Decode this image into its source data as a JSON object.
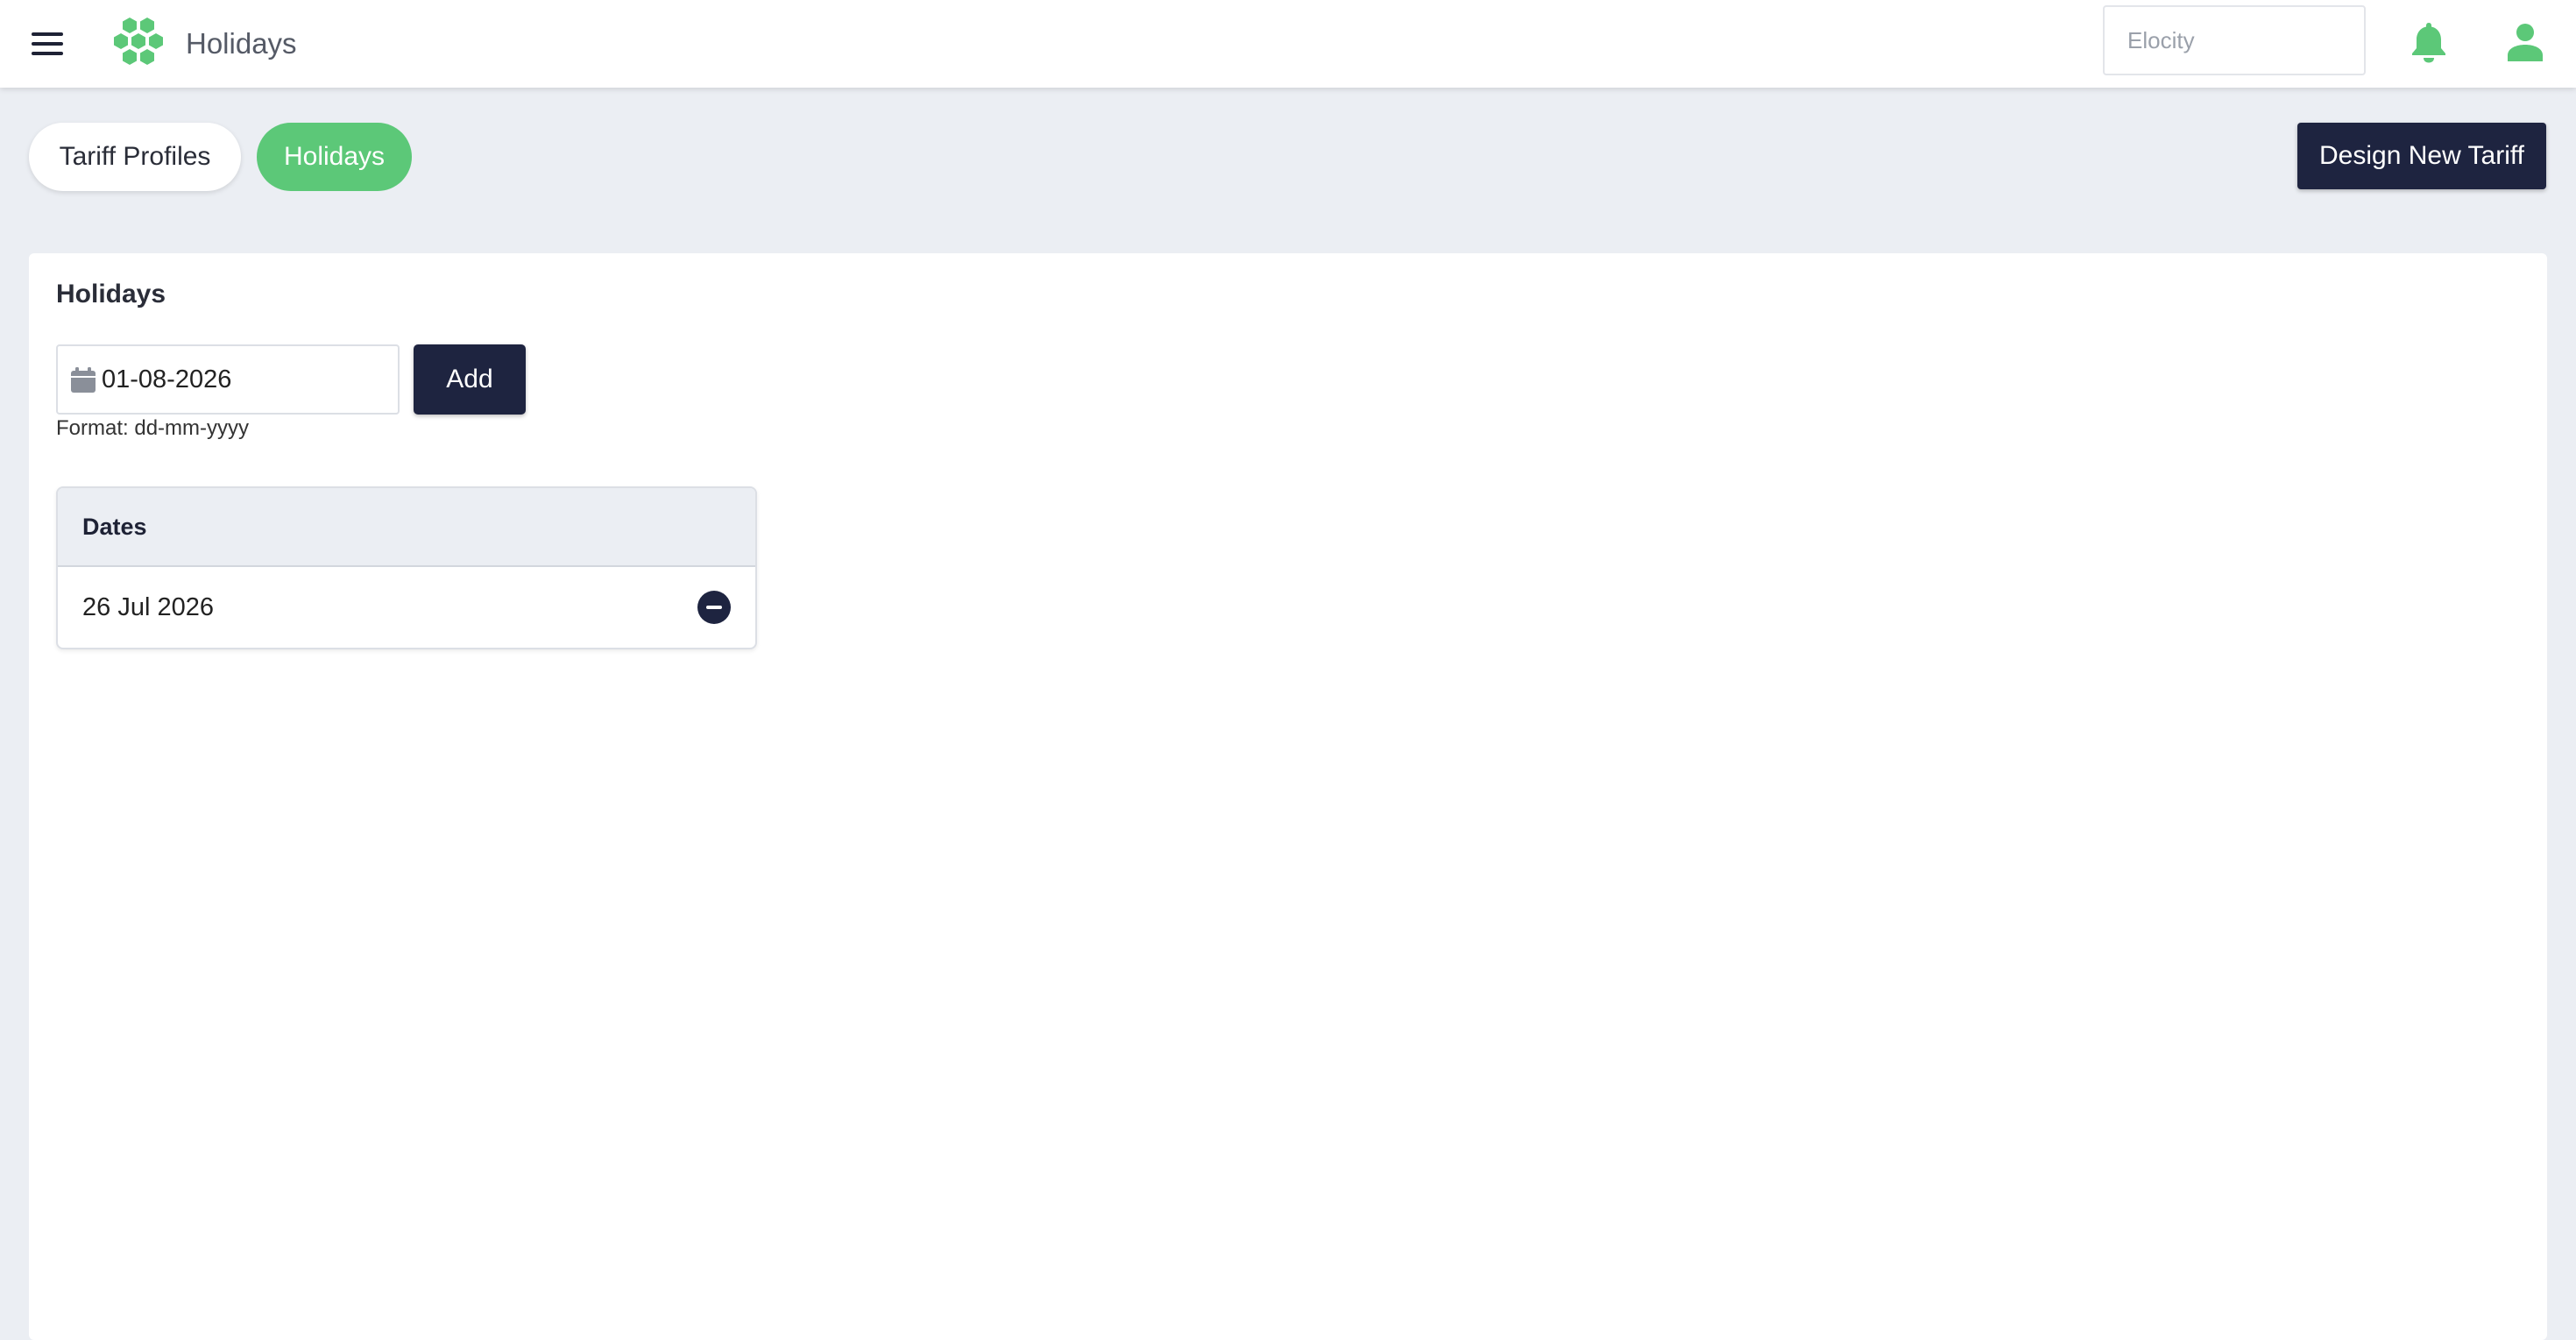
{
  "header": {
    "title": "Holidays",
    "org_placeholder": "Elocity",
    "menu_icon": "hamburger-menu-icon",
    "logo_icon": "hexagon-cluster-logo",
    "bell_icon": "bell-icon",
    "user_icon": "user-icon",
    "brand_color": "#5cc878",
    "dark_color": "#1e2440"
  },
  "tabs": [
    {
      "label": "Tariff Profiles",
      "active": false
    },
    {
      "label": "Holidays",
      "active": true
    }
  ],
  "actions": {
    "design_new_tariff": "Design New Tariff"
  },
  "holidays": {
    "title": "Holidays",
    "date_input_value": "01-08-2026",
    "calendar_icon": "calendar-icon",
    "add_label": "Add",
    "format_hint": "Format: dd-mm-yyyy",
    "table_header": "Dates",
    "dates": [
      {
        "label": "26 Jul 2026",
        "remove_icon": "minus-circle-icon"
      }
    ]
  }
}
